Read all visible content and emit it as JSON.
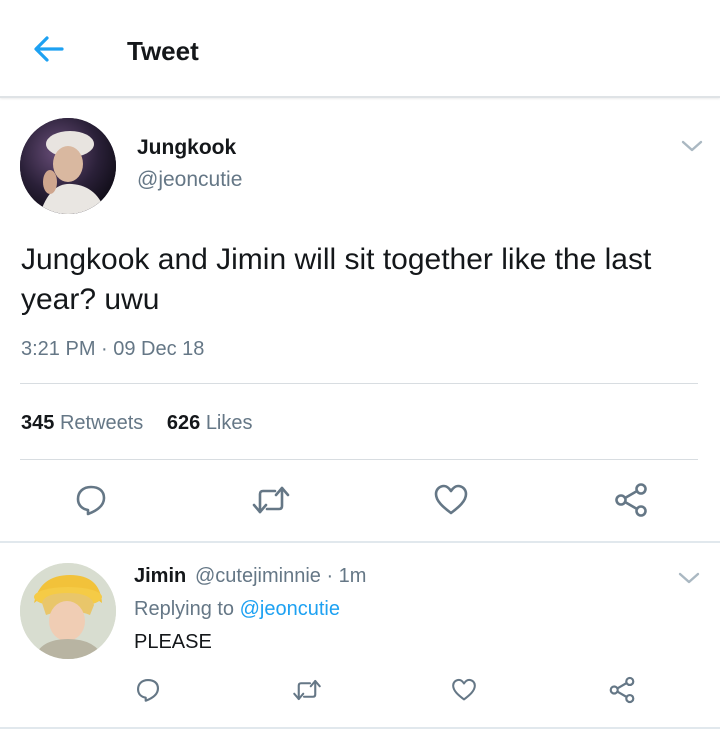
{
  "header": {
    "title": "Tweet",
    "back_icon": "arrow-left-icon",
    "accent_color": "#1da1f2"
  },
  "main_tweet": {
    "display_name": "Jungkook",
    "handle": "@jeoncutie",
    "text": "Jungkook and Jimin will sit together like the last year? uwu",
    "timestamp": "3:21 PM · 09 Dec 18",
    "retweets_count": "345",
    "retweets_label": "Retweets",
    "likes_count": "626",
    "likes_label": "Likes",
    "actions": [
      "reply-icon",
      "retweet-icon",
      "like-icon",
      "share-icon"
    ]
  },
  "reply_tweet": {
    "display_name": "Jimin",
    "handle_time": "@cutejiminnie · 1m",
    "replying_prefix": "Replying to",
    "replying_to": "@jeoncutie",
    "text": "PLEASE",
    "actions": [
      "reply-icon",
      "retweet-icon",
      "like-icon",
      "share-icon"
    ]
  },
  "colors": {
    "text_primary": "#14171a",
    "text_secondary": "#657786",
    "divider": "#e1e8ed",
    "icon": "#657786"
  }
}
